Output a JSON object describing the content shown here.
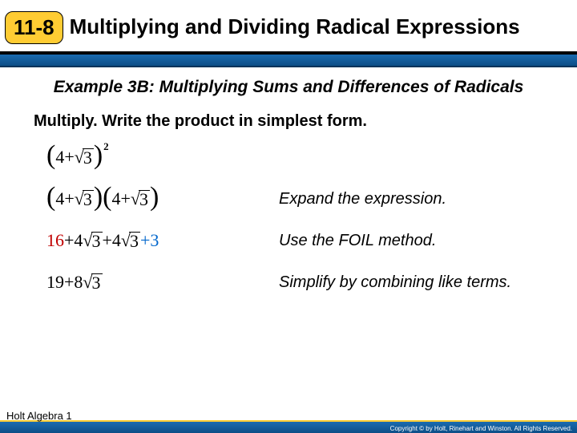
{
  "header": {
    "lesson_number": "11-8",
    "lesson_title": "Multiplying and Dividing Radical Expressions"
  },
  "example": {
    "title": "Example 3B: Multiplying Sums and Differences of Radicals",
    "instruction": "Multiply. Write the product in simplest form."
  },
  "steps": {
    "s1": {
      "four": "4",
      "plus": " + ",
      "rad": "3"
    },
    "s2": {
      "four": "4",
      "plus": " + ",
      "rad": "3",
      "note": "Expand the expression."
    },
    "s3": {
      "first": "16",
      "p1": " + ",
      "mid1a": "4",
      "mid1r": "3",
      "p2": " + ",
      "mid2a": "4",
      "mid2r": "3",
      "p3": " + ",
      "last": "3",
      "note": "Use the FOIL method."
    },
    "s4": {
      "a": "19",
      "plus": " + ",
      "b": "8",
      "rad": "3",
      "note": "Simplify by combining like terms."
    }
  },
  "footer": {
    "brand": "Holt Algebra 1",
    "copyright": "Copyright © by Holt, Rinehart and Winston. All Rights Reserved."
  }
}
